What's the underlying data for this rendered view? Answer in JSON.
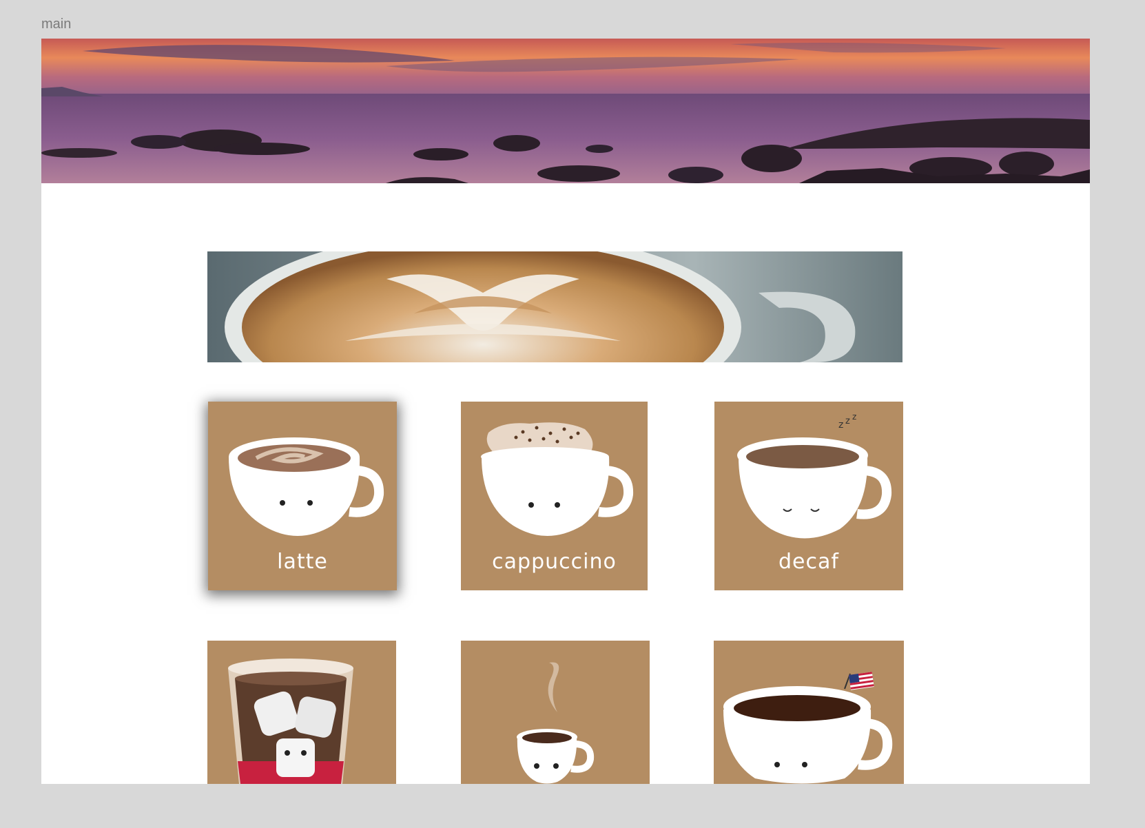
{
  "frame": {
    "label": "main"
  },
  "hero": {
    "alt": "sunset over rocky sea"
  },
  "banner": {
    "alt": "latte art coffee cup"
  },
  "products": [
    {
      "label": "latte",
      "icon": "latte-cup-icon",
      "selected": true
    },
    {
      "label": "cappuccino",
      "icon": "cappuccino-cup-icon",
      "selected": false
    },
    {
      "label": "decaf",
      "icon": "decaf-cup-icon",
      "selected": false
    },
    {
      "label": "",
      "icon": "iced-coffee-icon",
      "selected": false
    },
    {
      "label": "",
      "icon": "espresso-cup-icon",
      "selected": false
    },
    {
      "label": "",
      "icon": "americano-cup-icon",
      "selected": false
    }
  ],
  "colors": {
    "canvas": "#d8d8d8",
    "artboard": "#ffffff",
    "tile": "#b48d63",
    "coffee": "#6e4a32",
    "label": "#7a7a7a"
  }
}
